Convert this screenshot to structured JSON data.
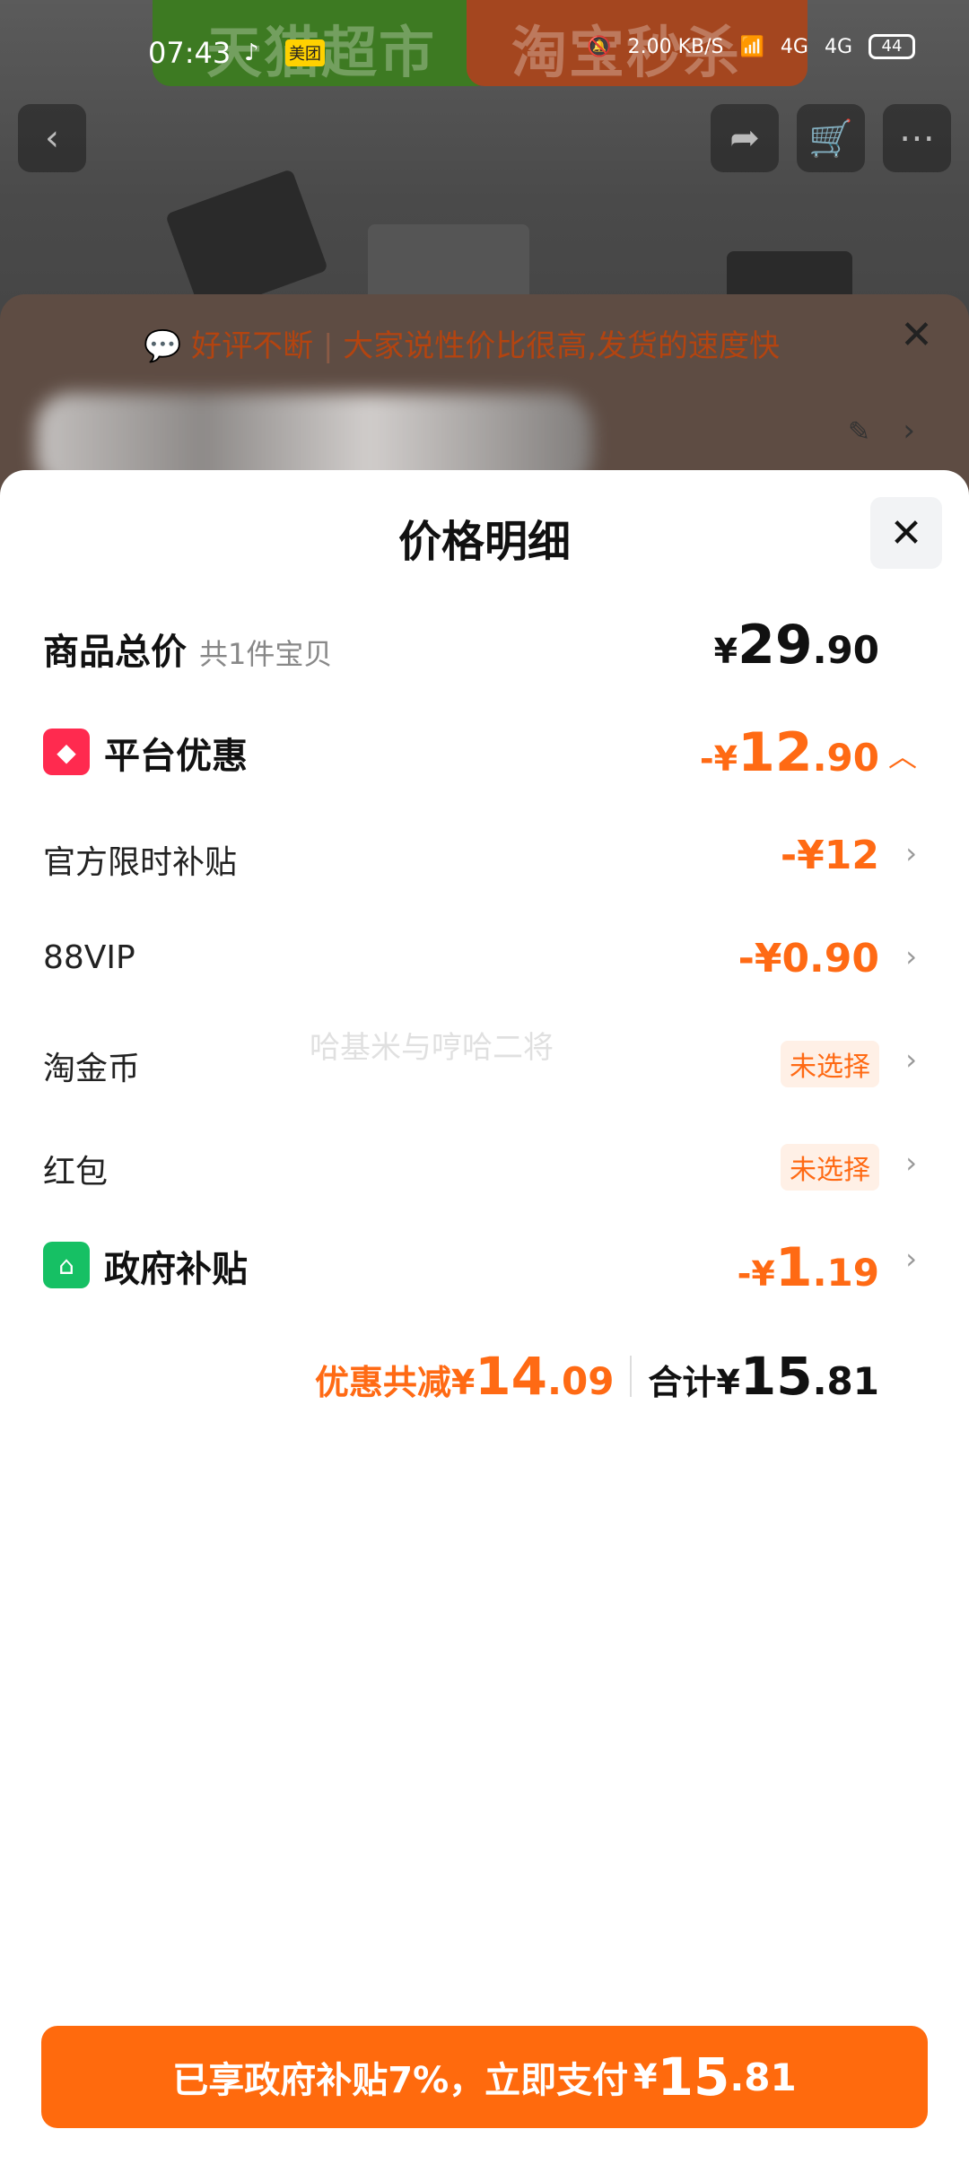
{
  "status_bar": {
    "time": "07:43",
    "apps": [
      "♪",
      "美团"
    ],
    "net_speed": "2.00 KB/S",
    "signal_1": "4G",
    "signal_2": "4G",
    "battery": "44"
  },
  "background": {
    "banner_left": "天猫超市",
    "banner_right": "淘宝秒杀",
    "review_tip": {
      "label": "好评不断",
      "text": "大家说性价比很高,发货的速度快"
    }
  },
  "sheet": {
    "title": "价格明细",
    "total_row": {
      "label": "商品总价",
      "note": "共1件宝贝",
      "symbol": "¥",
      "int": "29",
      "dec": ".90"
    },
    "platform_row": {
      "label": "平台优惠",
      "sign_symbol": "-¥",
      "int": "12",
      "dec": ".90"
    },
    "items": [
      {
        "label": "官方限时补贴",
        "amount": "-¥12"
      },
      {
        "label": "88VIP",
        "amount": "-¥0.90"
      },
      {
        "label": "淘金币",
        "tag": "未选择"
      },
      {
        "label": "红包",
        "tag": "未选择"
      }
    ],
    "gov_row": {
      "label": "政府补贴",
      "sign_symbol": "-¥",
      "int": "1",
      "dec": ".19"
    },
    "summary": {
      "discount_label": "优惠共减¥",
      "discount_int": "14",
      "discount_dec": ".09",
      "total_label": "合计¥",
      "total_int": "15",
      "total_dec": ".81"
    },
    "watermark": "哈基米与哼哈二将"
  },
  "pay_button": {
    "text": "已享政府补贴7%，立即支付",
    "symbol": "¥",
    "int": "15",
    "dec": ".81"
  },
  "colors": {
    "accent": "#ff6a14",
    "pay_button": "#ff6a0d",
    "coupon_icon": "#ff2a4f",
    "gov_icon": "#16c064"
  }
}
